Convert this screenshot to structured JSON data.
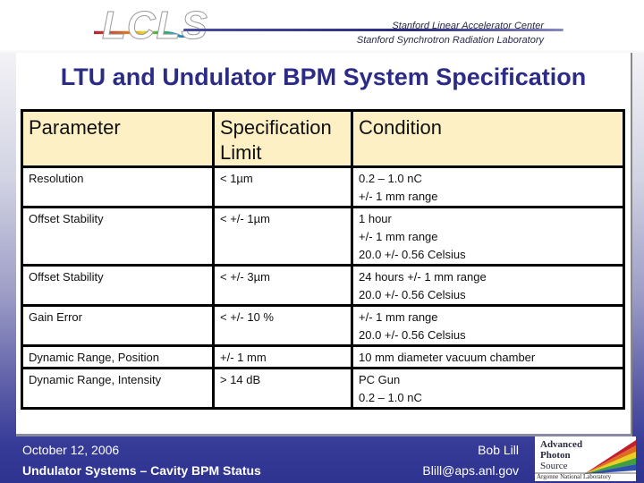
{
  "header": {
    "logo_text": "LCLS",
    "org_line_1": "Stanford Linear Accelerator Center",
    "org_line_2": "Stanford Synchrotron Radiation Laboratory"
  },
  "slide": {
    "title": "LTU and Undulator BPM System Specification",
    "table": {
      "headers": [
        "Parameter",
        "Specification Limit",
        "Condition"
      ],
      "rows": [
        {
          "parameter": "Resolution",
          "limit": "< 1µm",
          "condition": [
            "0.2 – 1.0 nC",
            "+/- 1 mm range"
          ]
        },
        {
          "parameter": "Offset Stability",
          "limit": "< +/- 1µm",
          "condition": [
            "1 hour",
            "+/- 1 mm range",
            "20.0 +/- 0.56 Celsius"
          ]
        },
        {
          "parameter": "Offset Stability",
          "limit": "< +/- 3µm",
          "condition": [
            "24 hours +/- 1 mm range",
            "20.0 +/- 0.56 Celsius"
          ]
        },
        {
          "parameter": "Gain Error",
          "limit": "< +/- 10 %",
          "condition": [
            "+/- 1 mm range",
            "20.0 +/- 0.56 Celsius"
          ]
        },
        {
          "parameter": "Dynamic Range, Position",
          "limit": "+/- 1 mm",
          "condition": [
            "10 mm diameter vacuum chamber"
          ]
        },
        {
          "parameter": "Dynamic Range, Intensity",
          "limit": "> 14 dB",
          "condition": [
            "PC Gun",
            "0.2 – 1.0 nC"
          ]
        }
      ]
    }
  },
  "footer": {
    "date": "October 12, 2006",
    "presentation_title": "Undulator Systems – Cavity BPM Status",
    "author": "Bob Lill",
    "email": "Blill@aps.anl.gov",
    "aps_logo": {
      "line1": "Advanced",
      "line2": "Photon",
      "line3": "Source",
      "lab": "Argonne National Laboratory"
    }
  },
  "colors": {
    "title": "#2c2c86",
    "header_row_bg": "#fdf0c4",
    "footer_bg": "#353a97"
  }
}
